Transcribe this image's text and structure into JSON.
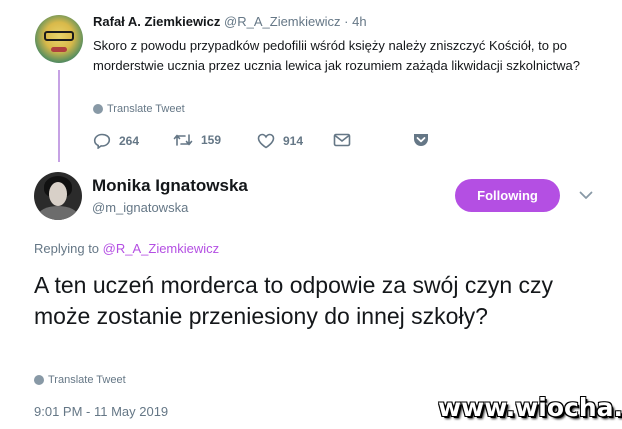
{
  "parent_tweet": {
    "author_name": "Rafał A. Ziemkiewicz",
    "handle": "@R_A_Ziemkiewicz",
    "separator": "·",
    "time": "4h",
    "text": "Skoro z powodu przypadków pedofilii wśród księży należy zniszczyć Kościół, to po morderstwie ucznia przez ucznia lewica jak rozumiem zażąda likwidacji szkolnictwa?",
    "translate_label": "Translate Tweet",
    "reply_count": "264",
    "retweet_count": "159",
    "like_count": "914",
    "icons": [
      "reply-icon",
      "retweet-icon",
      "like-icon",
      "direct-message-icon",
      "bookmark-icon"
    ]
  },
  "main_tweet": {
    "author_name": "Monika Ignatowska",
    "handle": "@m_ignatowska",
    "follow_label": "Following",
    "replying_prefix": "Replying to ",
    "replying_to": "@R_A_Ziemkiewicz",
    "text": "A ten uczeń morderca to odpowie za swój czyn czy może zostanie przeniesiony do innej szkoły?",
    "translate_label": "Translate Tweet",
    "timestamp": "9:01 PM - 11 May 2019"
  },
  "watermark": "www.wiocha.pl",
  "colors": {
    "accent": "#b44fe3",
    "thread_line": "#c6a2e4",
    "secondary_text": "#657786",
    "primary_text": "#14171a"
  }
}
